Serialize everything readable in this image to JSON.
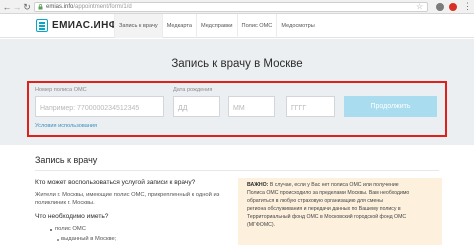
{
  "browser": {
    "url_host": "emias.info",
    "url_path": "/appointment/form/1/d",
    "back_icon": "arrow-left-icon",
    "forward_icon": "arrow-right-icon",
    "reload_icon": "reload-icon",
    "lock_icon": "lock-icon",
    "bookmark_icon": "star-icon",
    "menu_icon": "kebab-menu-icon",
    "back_glyph": "←",
    "forward_glyph": "→",
    "reload_glyph": "↻",
    "star_glyph": "☆",
    "menu_glyph": "⋮"
  },
  "header": {
    "brand": "ЕМИАС.ИНФО",
    "nav": [
      "Запись к врачу",
      "Медкарта",
      "Медсправки",
      "Полис ОМС",
      "Медосмотры"
    ],
    "active_index": 0
  },
  "form": {
    "title": "Запись к врачу в Москве",
    "policy_label": "Номер полиса ОМС",
    "policy_placeholder": "Например: 7700000234512345",
    "dob_label": "Дата рождения",
    "day_placeholder": "ДД",
    "month_placeholder": "ММ",
    "year_placeholder": "ГГГГ",
    "submit_label": "Продолжить",
    "terms_link": "Условия использования"
  },
  "content": {
    "title": "Запись к врачу",
    "q1": "Кто может воспользоваться услугой записи к врачу?",
    "p1_line1": "Жители г. Москвы, имеющие полис ОМС, прикрепленный к одной из",
    "p1_line2": "поликлиник г. Москвы.",
    "q2": "Что необходимо иметь?",
    "bullet1": "полис ОМС",
    "sub_bullet1": "выданный в Москве;",
    "notice_bold": "ВАЖНО:",
    "notice_lines": [
      " В случае, если у Вас нет полиса ОМС или получение",
      "Полиса ОМС происходило за пределами Москвы. Вам необходимо",
      "обратиться в любую страховую организацию для смены",
      "региона обслуживания и передачи данных по Вашему полису в",
      "Территориальный фонд ОМС в Московский городской фонд ОМС",
      "(МГФОМС)."
    ]
  },
  "colors": {
    "accent": "#0ba5c6",
    "button": "#a9dcee",
    "highlight_frame": "#e0201a",
    "notice_bg": "#fdf1de"
  }
}
